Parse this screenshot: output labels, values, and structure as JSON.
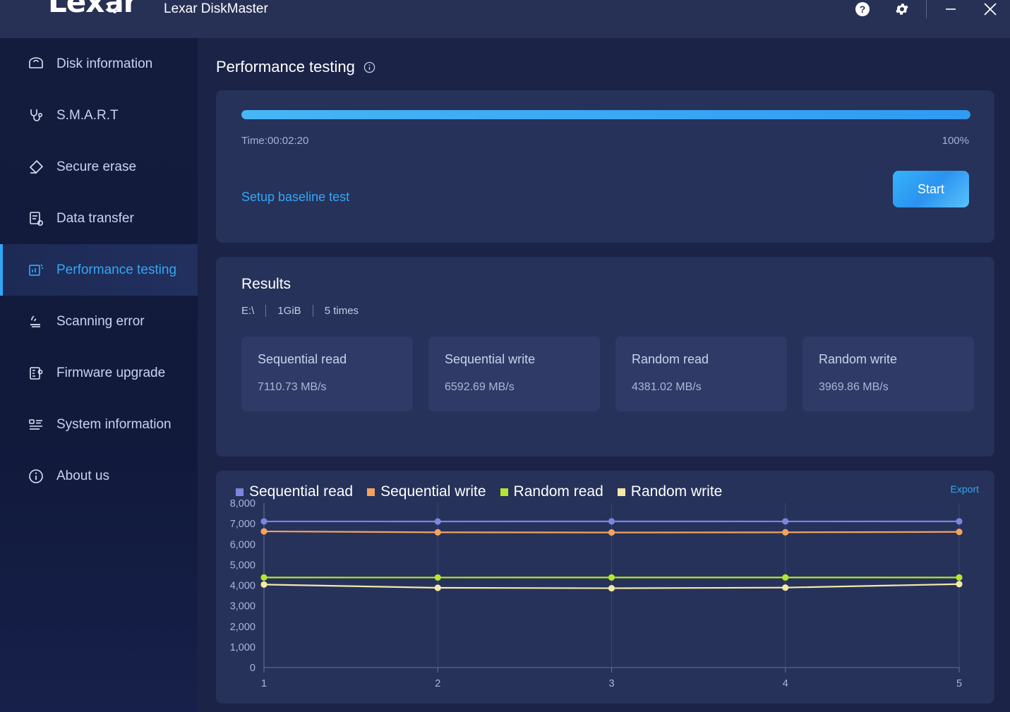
{
  "titlebar": {
    "logo_text": "Lexar",
    "app_title": "Lexar DiskMaster",
    "help_icon": "help-circle-icon",
    "settings_icon": "gear-icon",
    "minimize_icon": "minimize-icon",
    "close_icon": "close-icon"
  },
  "sidebar": {
    "items": [
      {
        "label": "Disk information",
        "icon": "hard-disk-icon",
        "active": false
      },
      {
        "label": "S.M.A.R.T",
        "icon": "stethoscope-icon",
        "active": false
      },
      {
        "label": "Secure erase",
        "icon": "eraser-icon",
        "active": false
      },
      {
        "label": "Data transfer",
        "icon": "file-transfer-icon",
        "active": false
      },
      {
        "label": "Performance testing",
        "icon": "performance-chart-icon",
        "active": true
      },
      {
        "label": "Scanning error",
        "icon": "scan-error-icon",
        "active": false
      },
      {
        "label": "Firmware upgrade",
        "icon": "firmware-chip-icon",
        "active": false
      },
      {
        "label": "System information",
        "icon": "system-list-icon",
        "active": false
      },
      {
        "label": "About us",
        "icon": "info-circle-icon",
        "active": false
      }
    ]
  },
  "page": {
    "title": "Performance testing",
    "info_icon": "info-icon"
  },
  "progress": {
    "percent_value": 100,
    "percent_label": "100%",
    "time_label": "Time:00:02:20",
    "baseline_link": "Setup baseline test",
    "start_button": "Start"
  },
  "results": {
    "title": "Results",
    "drive": "E:\\",
    "size": "1GiB",
    "times": "5 times",
    "cards": [
      {
        "label": "Sequential read",
        "value": "7110.73 MB/s"
      },
      {
        "label": "Sequential write",
        "value": "6592.69 MB/s"
      },
      {
        "label": "Random read",
        "value": "4381.02 MB/s"
      },
      {
        "label": "Random write",
        "value": "3969.86 MB/s"
      }
    ]
  },
  "chart_panel": {
    "export_label": "Export"
  },
  "colors": {
    "accent": "#32a7f5",
    "panel": "#26325a",
    "card": "#2f3b66",
    "titlebar": "#273156",
    "sidebar_top": "#141c3e",
    "series_sequential_read": "#7b86e0",
    "series_sequential_write": "#f5a35c",
    "series_random_read": "#b5e52e",
    "series_random_write": "#f6e9a8"
  },
  "chart_data": {
    "type": "line",
    "title": "",
    "xlabel": "",
    "ylabel": "",
    "x": [
      1,
      2,
      3,
      4,
      5
    ],
    "xtick_labels": [
      "1",
      "2",
      "3",
      "4",
      "5"
    ],
    "ytick_labels": [
      "0",
      "1,000",
      "2,000",
      "3,000",
      "4,000",
      "5,000",
      "6,000",
      "7,000",
      "8,000"
    ],
    "ylim": [
      0,
      8000
    ],
    "xlim": [
      1,
      5
    ],
    "grid": true,
    "legend_position": "top-left",
    "series": [
      {
        "name": "Sequential read",
        "color": "#7b86e0",
        "values": [
          7110,
          7108,
          7112,
          7110,
          7111
        ]
      },
      {
        "name": "Sequential write",
        "color": "#f5a35c",
        "values": [
          6625,
          6580,
          6570,
          6580,
          6600
        ]
      },
      {
        "name": "Random read",
        "color": "#b5e52e",
        "values": [
          4381,
          4380,
          4382,
          4381,
          4381
        ]
      },
      {
        "name": "Random write",
        "color": "#f6e9a8",
        "values": [
          4040,
          3880,
          3860,
          3890,
          4060
        ]
      }
    ]
  }
}
